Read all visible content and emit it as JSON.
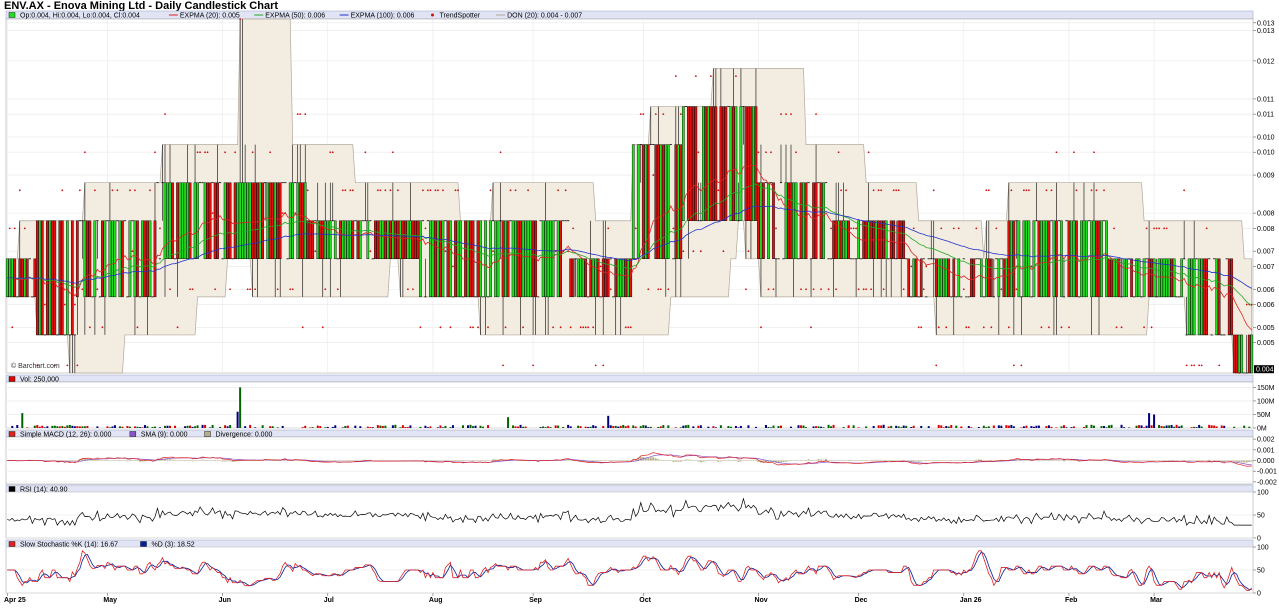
{
  "title": "ENV.AX - Enova Mining Ltd - Daily Candlestick Chart",
  "watermark": "© Barchart.com",
  "colors": {
    "up": "#22dd22",
    "down": "#e01010",
    "ema20": "#dd2222",
    "ema50": "#22aa22",
    "ema100": "#2233cc",
    "donchian_fill": "#f3ece0",
    "donchian_line": "#b0a89a",
    "dots": "#cc1111",
    "panel_bar": "#e0e4f4",
    "grid": "#e8e8e8",
    "volume_up": "#006400",
    "volume_down": "#00007f",
    "volume_red": "#dd0000"
  },
  "chart_data": [
    {
      "type": "candlestick",
      "panel": "price",
      "legend": [
        {
          "label": "Op:0.004, Hi:0.004, Lo:0.004, Cl:0.004",
          "color": "#22dd22",
          "marker": "box"
        },
        {
          "label": "EXPMA (20): 0.005",
          "color": "#dd2222",
          "marker": "line"
        },
        {
          "label": "EXPMA (50): 0.006",
          "color": "#22aa22",
          "marker": "line"
        },
        {
          "label": "EXPMA (100): 0.006",
          "color": "#2233cc",
          "marker": "line"
        },
        {
          "label": "TrendSpotter",
          "color": "#cc1111",
          "marker": "dot"
        },
        {
          "label": "DON (20): 0.004 - 0.007",
          "color": "#b0a89a",
          "marker": "line"
        }
      ],
      "y_ticks": [
        "0.013",
        "0.013",
        "0.012",
        "0.011",
        "0.011",
        "0.010",
        "0.010",
        "0.009",
        "0.008",
        "0.008",
        "0.007",
        "0.007",
        "0.006",
        "0.006",
        "0.005",
        "0.005"
      ],
      "ylim": [
        0.004,
        0.0133
      ],
      "last_value": "0.004",
      "levels": [
        0.004,
        0.005,
        0.006,
        0.007,
        0.008,
        0.009,
        0.01,
        0.011,
        0.013
      ],
      "segments": [
        {
          "from": 0,
          "to": 12,
          "lo": 0.006,
          "hi": 0.007,
          "ema20": 0.007
        },
        {
          "from": 12,
          "to": 28,
          "lo": 0.005,
          "hi": 0.008,
          "ema20": 0.0068
        },
        {
          "from": 28,
          "to": 60,
          "lo": 0.006,
          "hi": 0.008,
          "ema20": 0.0069
        },
        {
          "from": 60,
          "to": 80,
          "lo": 0.007,
          "hi": 0.009,
          "ema20": 0.0072
        },
        {
          "from": 80,
          "to": 120,
          "lo": 0.007,
          "hi": 0.009,
          "ema20": 0.0076
        },
        {
          "from": 120,
          "to": 165,
          "lo": 0.007,
          "hi": 0.008,
          "ema20": 0.0075
        },
        {
          "from": 165,
          "to": 225,
          "lo": 0.006,
          "hi": 0.008,
          "ema20": 0.0071
        },
        {
          "from": 225,
          "to": 250,
          "lo": 0.006,
          "hi": 0.007,
          "ema20": 0.0068
        },
        {
          "from": 250,
          "to": 270,
          "lo": 0.007,
          "hi": 0.01,
          "ema20": 0.0082
        },
        {
          "from": 270,
          "to": 300,
          "lo": 0.008,
          "hi": 0.011,
          "ema20": 0.0095
        },
        {
          "from": 300,
          "to": 330,
          "lo": 0.007,
          "hi": 0.009,
          "ema20": 0.0085
        },
        {
          "from": 330,
          "to": 360,
          "lo": 0.007,
          "hi": 0.008,
          "ema20": 0.0074
        },
        {
          "from": 360,
          "to": 400,
          "lo": 0.006,
          "hi": 0.007,
          "ema20": 0.0068
        },
        {
          "from": 400,
          "to": 440,
          "lo": 0.006,
          "hi": 0.008,
          "ema20": 0.007
        },
        {
          "from": 440,
          "to": 470,
          "lo": 0.006,
          "hi": 0.007,
          "ema20": 0.0069
        },
        {
          "from": 470,
          "to": 490,
          "lo": 0.005,
          "hi": 0.007,
          "ema20": 0.0059
        },
        {
          "from": 490,
          "to": 498,
          "lo": 0.004,
          "hi": 0.005,
          "ema20": 0.0053
        }
      ]
    },
    {
      "type": "bar",
      "panel": "volume",
      "legend": [
        {
          "label": "Vol: 250,000",
          "color": "#dd0000",
          "marker": "box"
        }
      ],
      "y_ticks": [
        "150M",
        "100M",
        "50M",
        "0M"
      ],
      "ylim": [
        0,
        170
      ],
      "unit": "M",
      "spikes": [
        {
          "i": 6,
          "v": 55,
          "c": "up"
        },
        {
          "i": 92,
          "v": 60,
          "c": "down"
        },
        {
          "i": 93,
          "v": 150,
          "c": "up"
        },
        {
          "i": 200,
          "v": 40,
          "c": "up"
        },
        {
          "i": 240,
          "v": 45,
          "c": "down"
        },
        {
          "i": 456,
          "v": 55,
          "c": "down"
        },
        {
          "i": 458,
          "v": 50,
          "c": "down"
        }
      ]
    },
    {
      "type": "line",
      "panel": "macd",
      "legend": [
        {
          "label": "Simple MACD (12, 26): 0.000",
          "color": "#dd2222",
          "marker": "box"
        },
        {
          "label": "SMA (9): 0.000",
          "color": "#8855cc",
          "marker": "box"
        },
        {
          "label": "Divergence: 0.000",
          "color": "#b5b08a",
          "marker": "box"
        }
      ],
      "y_ticks": [
        "0.002",
        "0.001",
        "0.000",
        "-0.001",
        "-0.002"
      ],
      "ylim": [
        -0.0022,
        0.0022
      ]
    },
    {
      "type": "line",
      "panel": "rsi",
      "legend": [
        {
          "label": "RSI (14): 40.90",
          "color": "#000000",
          "marker": "box"
        }
      ],
      "y_ticks": [
        "100",
        "50",
        "0"
      ],
      "ylim": [
        0,
        100
      ]
    },
    {
      "type": "line",
      "panel": "stochastic",
      "legend": [
        {
          "label": "Slow Stochastic %K (14): 16.67",
          "color": "#dd2222",
          "marker": "box"
        },
        {
          "label": "%D (3): 18.52",
          "color": "#001f9e",
          "marker": "box"
        }
      ],
      "y_ticks": [
        "100",
        "50",
        "0"
      ],
      "ylim": [
        0,
        100
      ]
    }
  ],
  "x_axis": {
    "labels": [
      "Apr 25",
      "May",
      "Jun",
      "Jul",
      "Aug",
      "Sep",
      "Oct",
      "Nov",
      "Dec",
      "Jan 26",
      "Feb",
      "Mar"
    ],
    "label_positions": [
      0,
      40,
      86,
      128,
      170,
      210,
      254,
      300,
      340,
      382,
      424,
      458
    ]
  }
}
